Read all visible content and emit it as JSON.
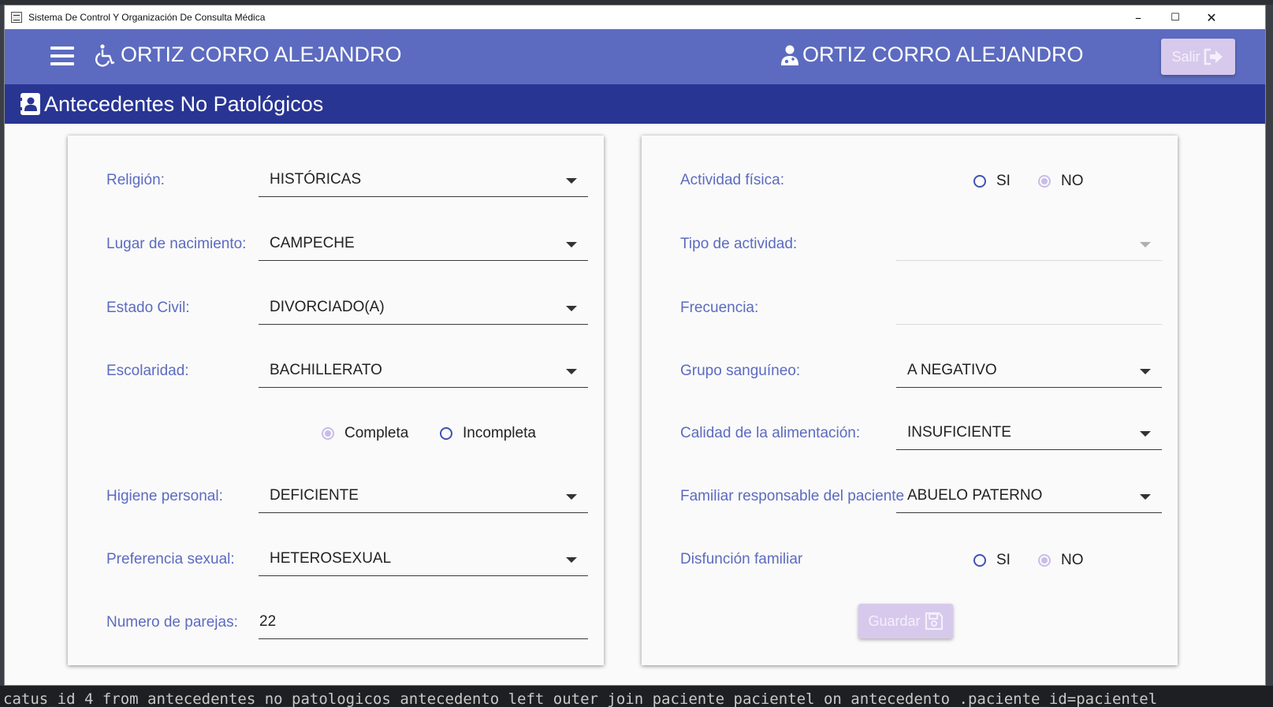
{
  "window": {
    "title": "Sistema De Control Y Organización De Consulta Médica",
    "controls": {
      "minimize": "–",
      "maximize": "☐",
      "close": "✕"
    }
  },
  "appbar": {
    "patient_name": "ORTIZ CORRO ALEJANDRO",
    "doctor_name": "ORTIZ CORRO ALEJANDRO",
    "exit_label": "Salir",
    "color": "#5c6bc0"
  },
  "section": {
    "title": "Antecedentes No Patológicos",
    "color": "#283593"
  },
  "left_form": {
    "religion": {
      "label": "Religión:",
      "value": "HISTÓRICAS"
    },
    "birthplace": {
      "label": "Lugar de nacimiento:",
      "value": "CAMPECHE"
    },
    "civil_status": {
      "label": "Estado Civil:",
      "value": "DIVORCIADO(A)"
    },
    "schooling": {
      "label": "Escolaridad:",
      "value": "BACHILLERATO"
    },
    "schooling_status": {
      "options": [
        "Completa",
        "Incompleta"
      ],
      "selected": "Completa"
    },
    "hygiene": {
      "label": "Higiene personal:",
      "value": "DEFICIENTE"
    },
    "sexual_preference": {
      "label": "Preferencia sexual:",
      "value": "HETEROSEXUAL"
    },
    "partners": {
      "label": "Numero de parejas:",
      "value": "22"
    }
  },
  "right_form": {
    "physical_activity": {
      "label": "Actividad física:",
      "options": [
        "SI",
        "NO"
      ],
      "selected": "NO"
    },
    "activity_type": {
      "label": "Tipo de actividad:",
      "value": ""
    },
    "frequency": {
      "label": "Frecuencia:",
      "value": ""
    },
    "blood_group": {
      "label": "Grupo sanguíneo:",
      "value": "A NEGATIVO"
    },
    "diet_quality": {
      "label": "Calidad de la alimentación:",
      "value": "INSUFICIENTE"
    },
    "responsible_relative": {
      "label": "Familiar responsable del paciente",
      "value": "ABUELO PATERNO"
    },
    "family_dysfunction": {
      "label": "Disfunción familiar",
      "options": [
        "SI",
        "NO"
      ],
      "selected": "NO"
    },
    "save_label": "Guardar"
  },
  "background_terminal_text": "catus_id 4  from antecedentes_no_patologicos antecedento  left outer join paciente pacientel  on antecedento .paciente_id=pacientel"
}
